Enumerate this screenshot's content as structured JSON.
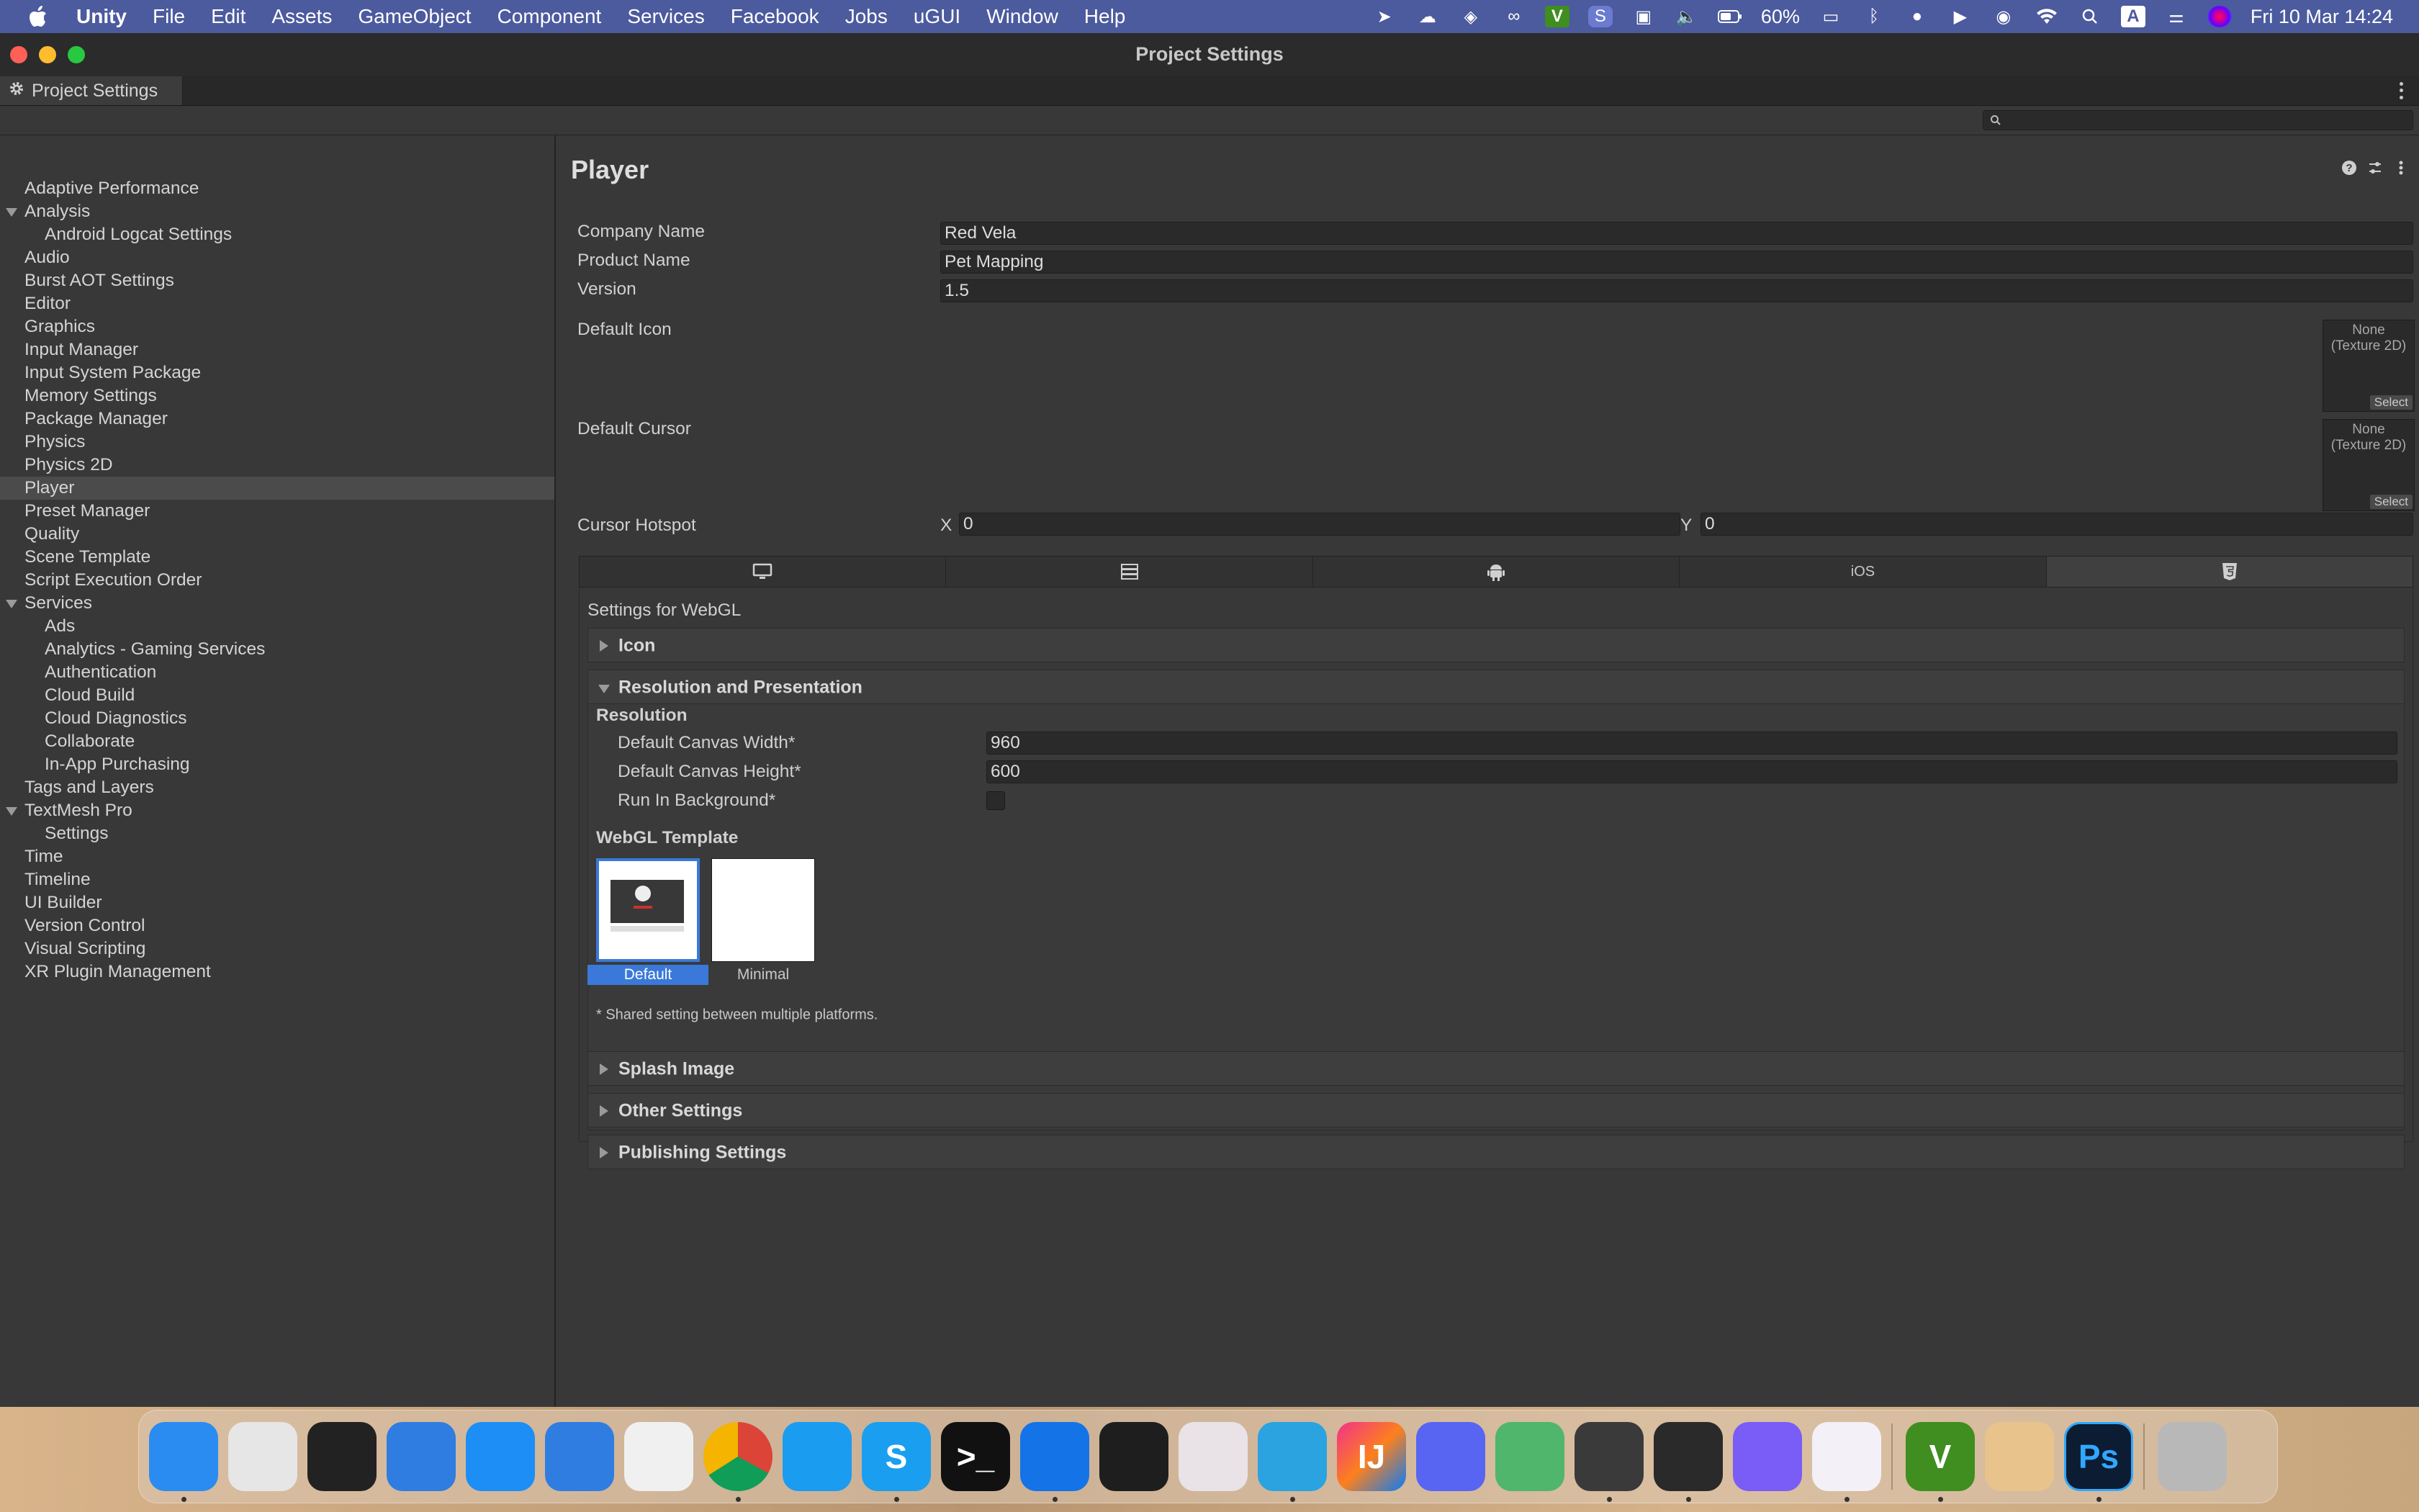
{
  "menubar": {
    "app_name": "Unity",
    "items": [
      "File",
      "Edit",
      "Assets",
      "GameObject",
      "Component",
      "Services",
      "Facebook",
      "Jobs",
      "uGUI",
      "Window",
      "Help"
    ],
    "battery": "60%",
    "datetime": "Fri 10 Mar  14:24",
    "input_source": "A"
  },
  "window": {
    "title": "Project Settings",
    "tab_label": "Project Settings",
    "search_placeholder": ""
  },
  "sidebar": {
    "items": [
      {
        "label": "Adaptive Performance",
        "level": 0
      },
      {
        "label": "Analysis",
        "level": 0,
        "expanded": true
      },
      {
        "label": "Android Logcat Settings",
        "level": 1
      },
      {
        "label": "Audio",
        "level": 0
      },
      {
        "label": "Burst AOT Settings",
        "level": 0
      },
      {
        "label": "Editor",
        "level": 0
      },
      {
        "label": "Graphics",
        "level": 0
      },
      {
        "label": "Input Manager",
        "level": 0
      },
      {
        "label": "Input System Package",
        "level": 0
      },
      {
        "label": "Memory Settings",
        "level": 0
      },
      {
        "label": "Package Manager",
        "level": 0
      },
      {
        "label": "Physics",
        "level": 0
      },
      {
        "label": "Physics 2D",
        "level": 0
      },
      {
        "label": "Player",
        "level": 0,
        "selected": true
      },
      {
        "label": "Preset Manager",
        "level": 0
      },
      {
        "label": "Quality",
        "level": 0
      },
      {
        "label": "Scene Template",
        "level": 0
      },
      {
        "label": "Script Execution Order",
        "level": 0
      },
      {
        "label": "Services",
        "level": 0,
        "expanded": true
      },
      {
        "label": "Ads",
        "level": 1
      },
      {
        "label": "Analytics - Gaming Services",
        "level": 1
      },
      {
        "label": "Authentication",
        "level": 1
      },
      {
        "label": "Cloud Build",
        "level": 1
      },
      {
        "label": "Cloud Diagnostics",
        "level": 1
      },
      {
        "label": "Collaborate",
        "level": 1
      },
      {
        "label": "In-App Purchasing",
        "level": 1
      },
      {
        "label": "Tags and Layers",
        "level": 0
      },
      {
        "label": "TextMesh Pro",
        "level": 0,
        "expanded": true
      },
      {
        "label": "Settings",
        "level": 1
      },
      {
        "label": "Time",
        "level": 0
      },
      {
        "label": "Timeline",
        "level": 0
      },
      {
        "label": "UI Builder",
        "level": 0
      },
      {
        "label": "Version Control",
        "level": 0
      },
      {
        "label": "Visual Scripting",
        "level": 0
      },
      {
        "label": "XR Plugin Management",
        "level": 0
      }
    ]
  },
  "player": {
    "title": "Player",
    "company_name_label": "Company Name",
    "company_name": "Red Vela",
    "product_name_label": "Product Name",
    "product_name": "Pet Mapping",
    "version_label": "Version",
    "version": "1.5",
    "default_icon_label": "Default Icon",
    "default_cursor_label": "Default Cursor",
    "texture_none": "None\n(Texture 2D)",
    "texture_select": "Select",
    "cursor_hotspot_label": "Cursor Hotspot",
    "hotspot_x_label": "X",
    "hotspot_x": "0",
    "hotspot_y_label": "Y",
    "hotspot_y": "0"
  },
  "platform_tabs": [
    {
      "name": "standalone",
      "icon": "monitor-icon",
      "label": ""
    },
    {
      "name": "server",
      "icon": "server-icon",
      "label": ""
    },
    {
      "name": "android",
      "icon": "android-icon",
      "label": ""
    },
    {
      "name": "ios",
      "icon": "",
      "label": "iOS"
    },
    {
      "name": "webgl",
      "icon": "html5-icon",
      "label": "",
      "active": true
    }
  ],
  "webgl": {
    "settings_for": "Settings for WebGL",
    "icon_section": "Icon",
    "resolution_section": "Resolution and Presentation",
    "resolution_heading": "Resolution",
    "canvas_width_label": "Default Canvas Width*",
    "canvas_width": "960",
    "canvas_height_label": "Default Canvas Height*",
    "canvas_height": "600",
    "run_in_background_label": "Run In Background*",
    "run_in_background": false,
    "template_heading": "WebGL Template",
    "templates": [
      {
        "label": "Default",
        "selected": true
      },
      {
        "label": "Minimal",
        "selected": false
      }
    ],
    "shared_note": "* Shared setting between multiple platforms.",
    "splash_section": "Splash Image",
    "other_section": "Other Settings",
    "publishing_section": "Publishing Settings"
  },
  "dock": {
    "apps": [
      {
        "name": "finder",
        "glyph": "",
        "color": "#2a8cf0",
        "running": true
      },
      {
        "name": "launchpad",
        "glyph": "",
        "color": "#e6e6e6",
        "running": false
      },
      {
        "name": "mission-control",
        "glyph": "",
        "color": "#222222",
        "running": false
      },
      {
        "name": "xcode",
        "glyph": "",
        "color": "#2f7de1",
        "running": false
      },
      {
        "name": "app-store",
        "glyph": "",
        "color": "#1d8ef5",
        "running": false
      },
      {
        "name": "xcode-beta",
        "glyph": "",
        "color": "#2f7de1",
        "running": false
      },
      {
        "name": "instruments",
        "glyph": "",
        "color": "#f0f0f0",
        "running": false
      },
      {
        "name": "chrome",
        "glyph": "",
        "color": "#f2f2f2",
        "running": true
      },
      {
        "name": "safari",
        "glyph": "",
        "color": "#1a9cf0",
        "running": false
      },
      {
        "name": "skype",
        "glyph": "S",
        "color": "#1a9ef0",
        "running": true
      },
      {
        "name": "terminal",
        "glyph": ">_",
        "color": "#111111",
        "running": false
      },
      {
        "name": "sourcetree",
        "glyph": "",
        "color": "#1473e6",
        "running": true
      },
      {
        "name": "figma",
        "glyph": "",
        "color": "#1e1e1e",
        "running": false
      },
      {
        "name": "sphere",
        "glyph": "",
        "color": "#e9e3e8",
        "running": false
      },
      {
        "name": "telegram",
        "glyph": "",
        "color": "#2aa3e0",
        "running": true
      },
      {
        "name": "intellij",
        "glyph": "IJ",
        "color": "#f2318a",
        "running": false
      },
      {
        "name": "discord",
        "glyph": "",
        "color": "#5865f2",
        "running": false
      },
      {
        "name": "android-studio",
        "glyph": "",
        "color": "#4fb66c",
        "running": false
      },
      {
        "name": "unity-hub",
        "glyph": "",
        "color": "#3a3a3a",
        "running": true
      },
      {
        "name": "unity",
        "glyph": "",
        "color": "#2a2a2a",
        "running": true
      },
      {
        "name": "messenger",
        "glyph": "",
        "color": "#7a5cf7",
        "running": false
      },
      {
        "name": "visual-studio",
        "glyph": "",
        "color": "#f3f0f7",
        "running": true
      },
      {
        "name": "vim",
        "glyph": "V",
        "color": "#3f8e1f",
        "running": true
      },
      {
        "name": "archive",
        "glyph": "",
        "color": "#e8c48c",
        "running": false
      },
      {
        "name": "photoshop",
        "glyph": "Ps",
        "color": "#0c1c33",
        "running": true
      },
      {
        "name": "trash",
        "glyph": "",
        "color": "#b8b8b8",
        "running": false
      }
    ]
  },
  "colors": {
    "accent": "#3a79d9",
    "menubar_bg": "#4c5a9e",
    "editor_bg": "#383838"
  }
}
